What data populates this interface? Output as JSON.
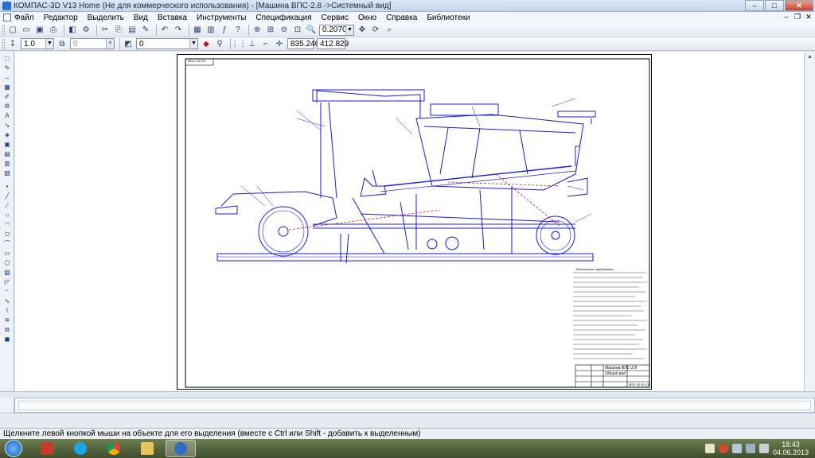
{
  "window": {
    "title": "КОМПАС-3D V13 Home (Не для коммерческого использования) - [Машина ВПС-2.8 ->Системный вид]",
    "buttons": {
      "minimize": "–",
      "maximize": "□",
      "close": "✕"
    }
  },
  "menu": {
    "items": [
      "Файл",
      "Редактор",
      "Выделить",
      "Вид",
      "Вставка",
      "Инструменты",
      "Спецификация",
      "Сервис",
      "Окно",
      "Справка",
      "Библиотеки"
    ]
  },
  "toolbar_main": {
    "zoom_value": "0.2070"
  },
  "toolbar_current": {
    "line_scale": "1.0",
    "layer_field": "0",
    "style_field": "0",
    "coord_x": "835.246",
    "coord_y": "412.829"
  },
  "drawing": {
    "stamp_top_left": "ВПС-2.8 СБ",
    "title_block_name": "Машина ВПС-2.8",
    "title_block_view": "Общий вид",
    "sheet_code": "ВПС 00 00 СБ",
    "note_title": "Технические требования"
  },
  "status_bar": {
    "text": "Щелкните левой кнопкой мыши на объекте для его выделения (вместе с Ctrl или Shift - добавить к выделенным)"
  },
  "taskbar": {
    "time": "18:43",
    "date": "04.06.2013",
    "apps": [
      "skype-icon",
      "chrome-icon",
      "explorer-icon",
      "kompas-icon"
    ]
  },
  "colors": {
    "drawing_blue": "#1a1ae6",
    "titlebar": "#c4d5ea",
    "taskbar": "#4b5a36"
  }
}
